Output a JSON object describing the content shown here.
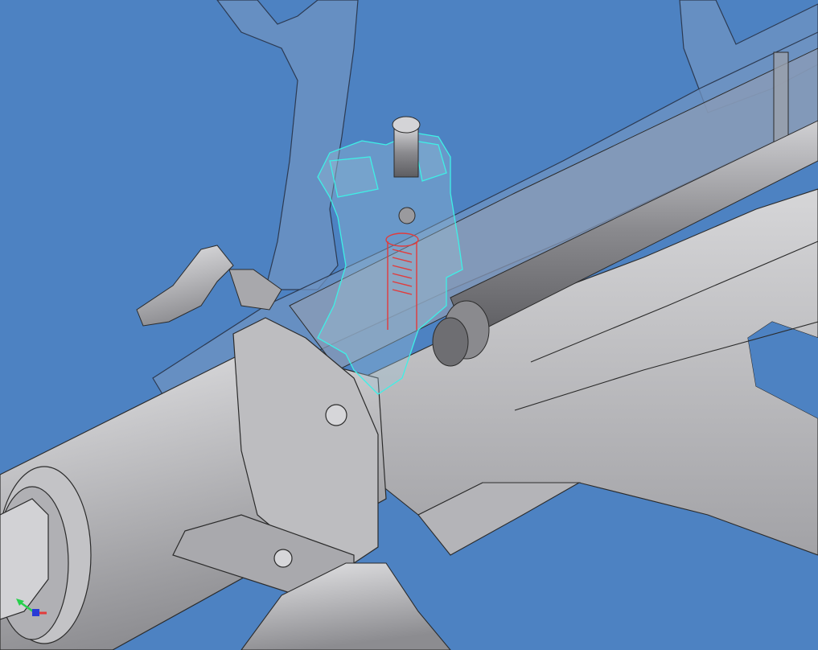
{
  "viewport": {
    "background": "#4d82c2",
    "model": {
      "body_fill": "#c9c9cc",
      "body_shade": "#9a9a9e",
      "edge": "#2b2b2b",
      "translucent_fill": "#6f93c2",
      "selected_edge": "#3ef0e6",
      "spring": "#e23b3b"
    },
    "triad": {
      "x_color": "#e23b3b",
      "y_color": "#26d04b",
      "z_color": "#2a3bd6"
    }
  }
}
